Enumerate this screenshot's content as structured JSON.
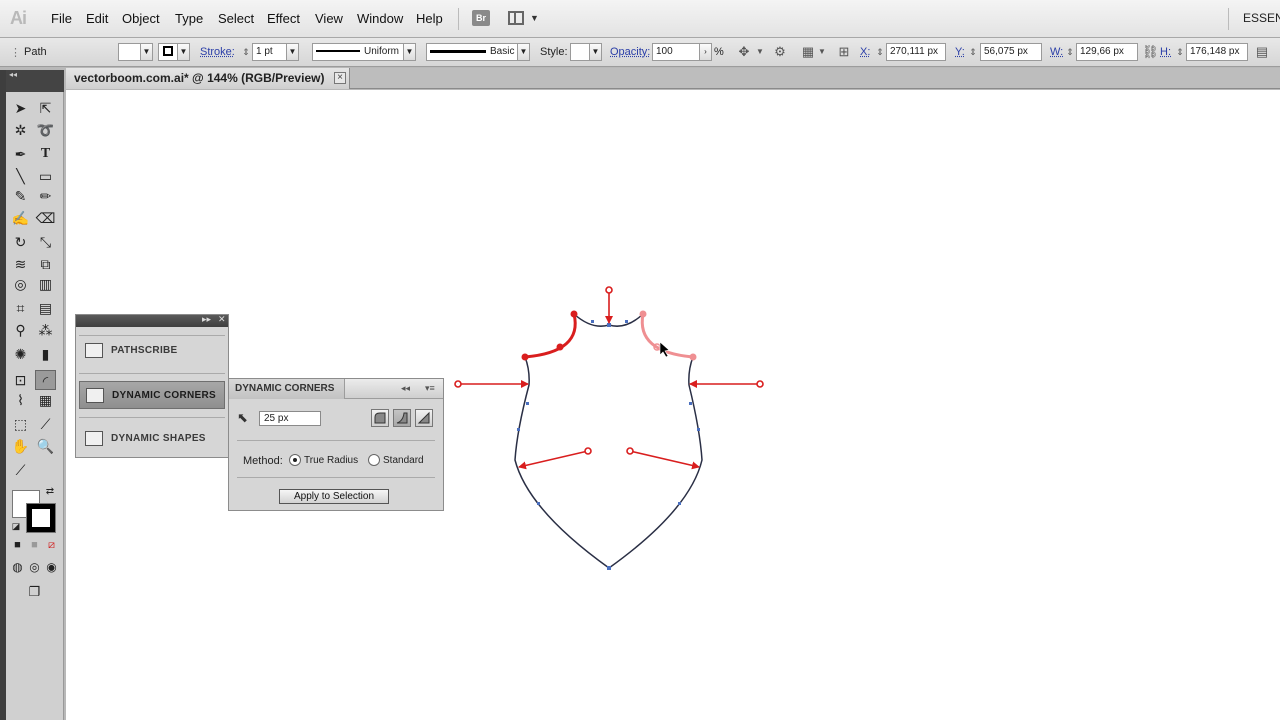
{
  "app": {
    "logo": "Ai",
    "workspace": "ESSEN",
    "bridge_label": "Br"
  },
  "menu": [
    "File",
    "Edit",
    "Object",
    "Type",
    "Select",
    "Effect",
    "View",
    "Window",
    "Help"
  ],
  "control": {
    "selection_type": "Path",
    "stroke_label": "Stroke:",
    "stroke_weight": "1 pt",
    "profile": "Uniform",
    "brush": "Basic",
    "style_label": "Style:",
    "opacity_label": "Opacity:",
    "opacity_value": "100",
    "opacity_unit": "%",
    "x_label": "X:",
    "x_value": "270,111 px",
    "y_label": "Y:",
    "y_value": "56,075 px",
    "w_label": "W:",
    "w_value": "129,66 px",
    "h_label": "H:",
    "h_value": "176,148 px"
  },
  "document": {
    "tab_title": "vectorboom.com.ai* @ 144% (RGB/Preview)",
    "close": "×"
  },
  "plugin_panel": {
    "items": [
      {
        "label": "PATHSCRIBE",
        "icon": "pathscribe-icon"
      },
      {
        "label": "DYNAMIC CORNERS",
        "icon": "dynamic-corners-icon"
      },
      {
        "label": "DYNAMIC SHAPES",
        "icon": "dynamic-shapes-icon"
      }
    ],
    "active_index": 1
  },
  "dynamic_corners": {
    "title": "DYNAMIC CORNERS",
    "radius": "25 px",
    "method_label": "Method:",
    "method_options": [
      "True Radius",
      "Standard"
    ],
    "selected_method": "True Radius",
    "apply_label": "Apply to Selection"
  },
  "colors": {
    "accent_red": "#d91e1e",
    "accent_pink": "#ef8f92",
    "path_blue": "#4a6fbf",
    "path_dark": "#2a2f45"
  }
}
